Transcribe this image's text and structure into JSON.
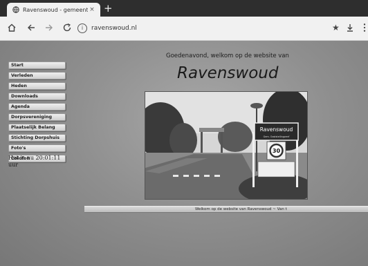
{
  "browser": {
    "tab_title": "Ravenswoud - gemeente Oo",
    "tab_close": "×",
    "new_tab": "+",
    "url": "ravenswoud.nl"
  },
  "page": {
    "welcome": "Goedenavond, welkom op de website van",
    "site_title": "Ravenswoud",
    "menu": [
      "Start",
      "Verleden",
      "Heden",
      "Downloads",
      "Agenda",
      "Dorpsvereniging",
      "Plaatselijk Belang",
      "Stichting Dorpshuis",
      "Foto's",
      "Colofon"
    ],
    "clock": "Het is nu 20:01:11 uur",
    "marquee": "Welkom op de website van Ravenswoud   ~   Van t",
    "sign": {
      "name": "Ravenswoud",
      "sub": "Gem. Ooststellingwerf",
      "limit": "30"
    }
  }
}
